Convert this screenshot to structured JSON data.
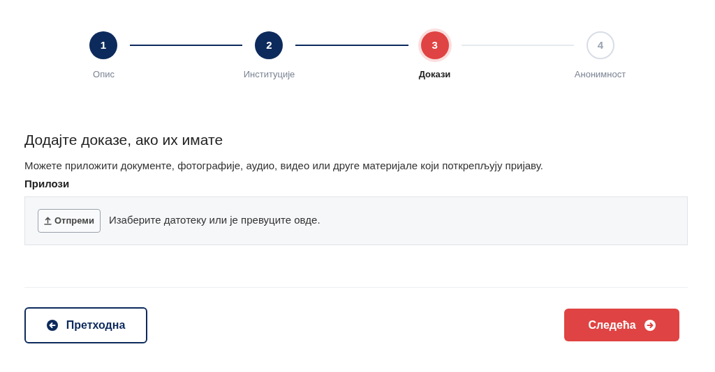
{
  "steps": [
    {
      "number": "1",
      "label": "Опис",
      "kind": "done"
    },
    {
      "number": "2",
      "label": "Институције",
      "kind": "done"
    },
    {
      "number": "3",
      "label": "Докази",
      "kind": "current"
    },
    {
      "number": "4",
      "label": "Анонимност",
      "kind": "upcoming"
    }
  ],
  "heading": "Додајте доказе, ако их имате",
  "description": "Можете приложити документе, фотографије, аудио, видео или друге материјале који поткрепљују пријаву.",
  "attachments": {
    "label": "Прилози",
    "upload_button": "Отпреми",
    "hint": "Изаберите датотеку или је превуците овде."
  },
  "buttons": {
    "previous": "Претходна",
    "next": "Следећа"
  }
}
